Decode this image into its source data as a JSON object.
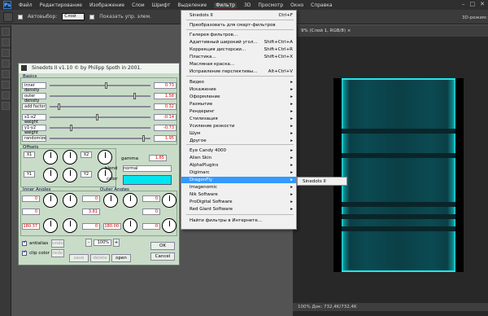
{
  "app": {
    "logo": "Ps"
  },
  "menubar": {
    "items": [
      "Файл",
      "Редактирование",
      "Изображение",
      "Слои",
      "Шрифт",
      "Выделение",
      "Фильтр",
      "3D",
      "Просмотр",
      "Окно",
      "Справка"
    ],
    "active_index": 6
  },
  "optbar": {
    "autoselect_label": "Автовыбор:",
    "autoselect_value": "Слой",
    "transform_label": "Показать упр. элем.",
    "mode_label": "3D-режим:"
  },
  "document": {
    "tab_title": "9% (Слой 1, RGB/8) ×",
    "status": "100%        Док: 732,4K/732,4K",
    "accent": "#1fe0e0"
  },
  "filter_menu": {
    "items": [
      {
        "label": "Sinedots II",
        "shortcut": "Ctrl+F",
        "arrow": ""
      },
      {
        "label": "Преобразовать для смарт-фильтров",
        "shortcut": "",
        "arrow": ""
      },
      {
        "label": "Галерея фильтров...",
        "shortcut": "",
        "arrow": ""
      },
      {
        "label": "Адаптивный широкий угол...",
        "shortcut": "Shift+Ctrl+A",
        "arrow": ""
      },
      {
        "label": "Коррекция дисторсии...",
        "shortcut": "Shift+Ctrl+R",
        "arrow": ""
      },
      {
        "label": "Пластика...",
        "shortcut": "Shift+Ctrl+X",
        "arrow": ""
      },
      {
        "label": "Масляная краска...",
        "shortcut": "",
        "arrow": ""
      },
      {
        "label": "Исправление перспективы...",
        "shortcut": "Alt+Ctrl+V",
        "arrow": ""
      },
      {
        "label": "Видео",
        "shortcut": "",
        "arrow": "▸"
      },
      {
        "label": "Искажение",
        "shortcut": "",
        "arrow": "▸"
      },
      {
        "label": "Оформление",
        "shortcut": "",
        "arrow": "▸"
      },
      {
        "label": "Размытие",
        "shortcut": "",
        "arrow": "▸"
      },
      {
        "label": "Рендеринг",
        "shortcut": "",
        "arrow": "▸"
      },
      {
        "label": "Стилизация",
        "shortcut": "",
        "arrow": "▸"
      },
      {
        "label": "Усиление резкости",
        "shortcut": "",
        "arrow": "▸"
      },
      {
        "label": "Шум",
        "shortcut": "",
        "arrow": "▸"
      },
      {
        "label": "Другое",
        "shortcut": "",
        "arrow": "▸"
      },
      {
        "label": "Eye Candy 4000",
        "shortcut": "",
        "arrow": "▸"
      },
      {
        "label": "Alien Skin",
        "shortcut": "",
        "arrow": "▸"
      },
      {
        "label": "AlphaPlugins",
        "shortcut": "",
        "arrow": "▸"
      },
      {
        "label": "Digimarc",
        "shortcut": "",
        "arrow": "▸"
      },
      {
        "label": "DragonFly",
        "shortcut": "",
        "arrow": "▸"
      },
      {
        "label": "Imagenomic",
        "shortcut": "",
        "arrow": "▸"
      },
      {
        "label": "Nik Software",
        "shortcut": "",
        "arrow": "▸"
      },
      {
        "label": "ProDigital Software",
        "shortcut": "",
        "arrow": "▸"
      },
      {
        "label": "Red Giant Software",
        "shortcut": "",
        "arrow": "▸"
      },
      {
        "label": "Найти фильтры в Интернете...",
        "shortcut": "",
        "arrow": ""
      }
    ],
    "highlighted_index": 21,
    "submenu_item": "Sinedots II"
  },
  "dialog": {
    "title": "Sinedots II v1.10   © by Philipp Spoth in 2001.",
    "basics_label": "Basics",
    "sliders": [
      {
        "name": "inner density",
        "value": "0.73"
      },
      {
        "name": "outer density",
        "value": "1.58"
      },
      {
        "name": "add factor",
        "value": "0.32"
      },
      {
        "name": "x1-x2 weight",
        "value": "-0.14"
      },
      {
        "name": "y1-y2 weight",
        "value": "-0.73"
      },
      {
        "name": "randomize",
        "value": "1.95"
      }
    ],
    "offsets_label": "Offsets",
    "offset_labels": [
      "X1",
      "X2",
      "Y1",
      "Y2"
    ],
    "gamma_label": "gamma",
    "gamma_value": "1.85",
    "blend_label": "blend",
    "blend_value": "normal",
    "color_label": "color",
    "inner_angles_label": "Inner Angles",
    "outer_angles_label": "Outer Angles",
    "angle_values": [
      "0",
      "0",
      "0",
      "0",
      "3.81",
      "0",
      "180.37",
      "0",
      "180.00",
      "0"
    ],
    "antialias_label": "antialias",
    "clipcolor_label": "clip color",
    "undo_label": "undo",
    "redo_label": "redo",
    "zoom_value": "100%",
    "save_label": "save",
    "delete_label": "delete",
    "open_label": "open",
    "ok_label": "OK",
    "cancel_label": "Cancel",
    "color_swatch": "#00e6f0"
  }
}
